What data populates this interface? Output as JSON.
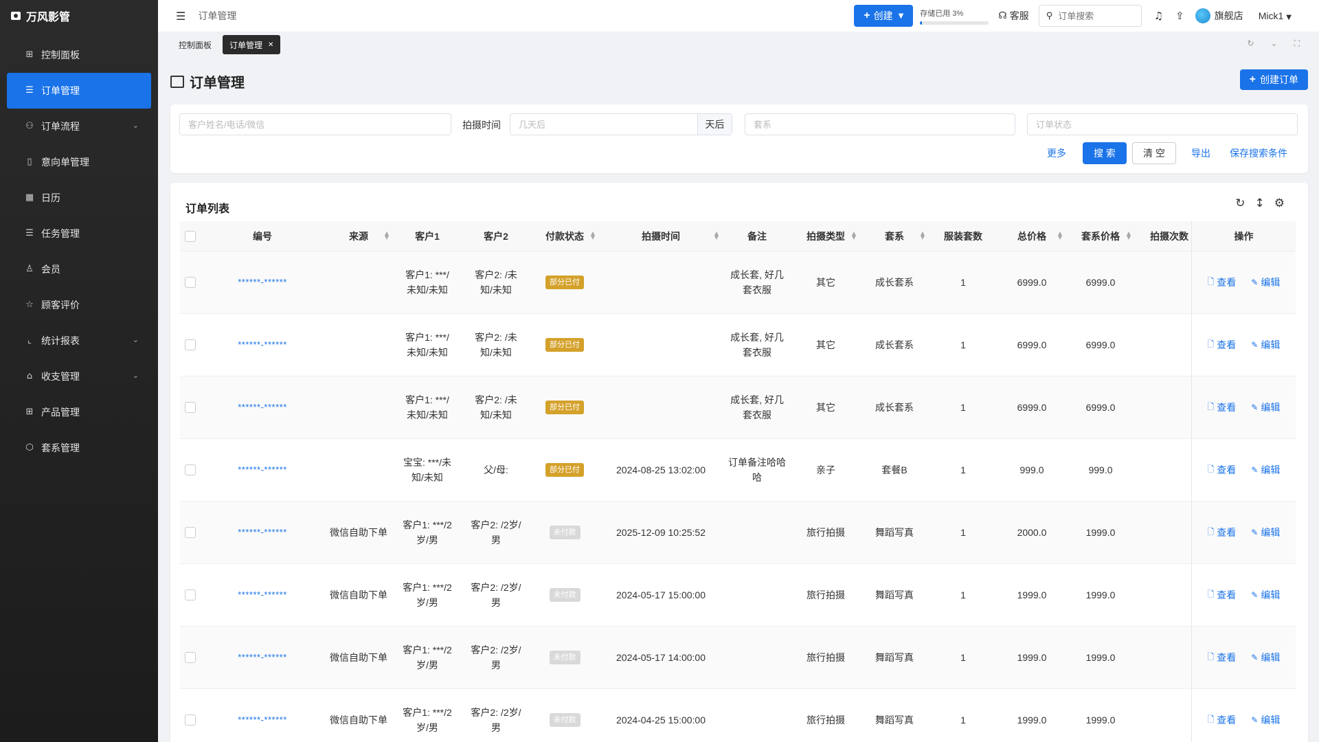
{
  "app": {
    "brand": "万风影管"
  },
  "sidebar": {
    "items": [
      {
        "label": "控制面板",
        "icon": "dashboard-icon",
        "glyph": "⊞"
      },
      {
        "label": "订单管理",
        "icon": "list-icon",
        "glyph": "☰",
        "active": true
      },
      {
        "label": "订单流程",
        "icon": "flow-icon",
        "glyph": "⚇",
        "expandable": true
      },
      {
        "label": "意向单管理",
        "icon": "clipboard-icon",
        "glyph": "▯"
      },
      {
        "label": "日历",
        "icon": "calendar-icon",
        "glyph": "▦"
      },
      {
        "label": "任务管理",
        "icon": "tasks-icon",
        "glyph": "☰"
      },
      {
        "label": "会员",
        "icon": "user-icon",
        "glyph": "♙"
      },
      {
        "label": "顾客评价",
        "icon": "star-icon",
        "glyph": "☆"
      },
      {
        "label": "统计报表",
        "icon": "chart-icon",
        "glyph": "⌞",
        "expandable": true
      },
      {
        "label": "收支管理",
        "icon": "bank-icon",
        "glyph": "⌂",
        "expandable": true
      },
      {
        "label": "产品管理",
        "icon": "grid-icon",
        "glyph": "⊞"
      },
      {
        "label": "套系管理",
        "icon": "box-icon",
        "glyph": "⬡"
      }
    ]
  },
  "header": {
    "title": "订单管理",
    "create_label": "创建",
    "storage_label": "存储已用 3%",
    "storage_percent": 3,
    "service_label": "客服",
    "search_placeholder": "订单搜索",
    "store_label": "旗舰店",
    "user_label": "Mick1"
  },
  "tabs": [
    {
      "label": "控制面板",
      "active": false
    },
    {
      "label": "订单管理",
      "active": true
    }
  ],
  "page": {
    "title": "订单管理",
    "create_order_label": "创建订单"
  },
  "filters": {
    "customer_placeholder": "客户姓名/电话/微信",
    "shoot_time_label": "拍摄时间",
    "days_placeholder": "几天后",
    "days_suffix": "天后",
    "package_placeholder": "套系",
    "status_placeholder": "订单状态",
    "more_label": "更多",
    "search_label": "搜 索",
    "clear_label": "清 空",
    "export_label": "导出",
    "save_label": "保存搜索条件"
  },
  "table": {
    "title": "订单列表",
    "columns": [
      "编号",
      "来源",
      "客户1",
      "客户2",
      "付款状态",
      "拍摄时间",
      "备注",
      "拍摄类型",
      "套系",
      "服装套数",
      "总价格",
      "套系价格",
      "拍摄次数",
      "操作"
    ],
    "view_label": "查看",
    "edit_label": "编辑",
    "colors": {
      "partial": "#d4a12a",
      "unpaid": "#d9d9d9",
      "accent": "#1a73e8"
    },
    "rows": [
      {
        "no": "******-******",
        "source": "",
        "c1": "客户1: ***/未知/未知",
        "c2": "客户2: /未知/未知",
        "pay": "部分已付",
        "pay_type": "partial",
        "time": "",
        "note": "成长套, 好几套衣服",
        "type": "其它",
        "pkg": "成长套系",
        "costumes": "1",
        "total": "6999.0",
        "pkg_price": "6999.0",
        "count": ""
      },
      {
        "no": "******-******",
        "source": "",
        "c1": "客户1: ***/未知/未知",
        "c2": "客户2: /未知/未知",
        "pay": "部分已付",
        "pay_type": "partial",
        "time": "",
        "note": "成长套, 好几套衣服",
        "type": "其它",
        "pkg": "成长套系",
        "costumes": "1",
        "total": "6999.0",
        "pkg_price": "6999.0",
        "count": ""
      },
      {
        "no": "******-******",
        "source": "",
        "c1": "客户1: ***/未知/未知",
        "c2": "客户2: /未知/未知",
        "pay": "部分已付",
        "pay_type": "partial",
        "time": "",
        "note": "成长套, 好几套衣服",
        "type": "其它",
        "pkg": "成长套系",
        "costumes": "1",
        "total": "6999.0",
        "pkg_price": "6999.0",
        "count": ""
      },
      {
        "no": "******-******",
        "source": "",
        "c1": "宝宝: ***/未知/未知",
        "c2": "父/母:",
        "pay": "部分已付",
        "pay_type": "partial",
        "time": "2024-08-25 13:02:00",
        "note": "订单备注哈哈哈",
        "type": "亲子",
        "pkg": "套餐B",
        "costumes": "1",
        "total": "999.0",
        "pkg_price": "999.0",
        "count": ""
      },
      {
        "no": "******-******",
        "source": "微信自助下单",
        "c1": "客户1: ***/2岁/男",
        "c2": "客户2: /2岁/男",
        "pay": "未付款",
        "pay_type": "unpaid",
        "time": "2025-12-09 10:25:52",
        "note": "",
        "type": "旅行拍摄",
        "pkg": "舞蹈写真",
        "costumes": "1",
        "total": "2000.0",
        "pkg_price": "1999.0",
        "count": ""
      },
      {
        "no": "******-******",
        "source": "微信自助下单",
        "c1": "客户1: ***/2岁/男",
        "c2": "客户2: /2岁/男",
        "pay": "未付款",
        "pay_type": "unpaid",
        "time": "2024-05-17 15:00:00",
        "note": "",
        "type": "旅行拍摄",
        "pkg": "舞蹈写真",
        "costumes": "1",
        "total": "1999.0",
        "pkg_price": "1999.0",
        "count": ""
      },
      {
        "no": "******-******",
        "source": "微信自助下单",
        "c1": "客户1: ***/2岁/男",
        "c2": "客户2: /2岁/男",
        "pay": "未付款",
        "pay_type": "unpaid",
        "time": "2024-05-17 14:00:00",
        "note": "",
        "type": "旅行拍摄",
        "pkg": "舞蹈写真",
        "costumes": "1",
        "total": "1999.0",
        "pkg_price": "1999.0",
        "count": ""
      },
      {
        "no": "******-******",
        "source": "微信自助下单",
        "c1": "客户1: ***/2岁/男",
        "c2": "客户2: /2岁/男",
        "pay": "未付款",
        "pay_type": "unpaid",
        "time": "2024-04-25 15:00:00",
        "note": "",
        "type": "旅行拍摄",
        "pkg": "舞蹈写真",
        "costumes": "1",
        "total": "1999.0",
        "pkg_price": "1999.0",
        "count": ""
      }
    ]
  }
}
